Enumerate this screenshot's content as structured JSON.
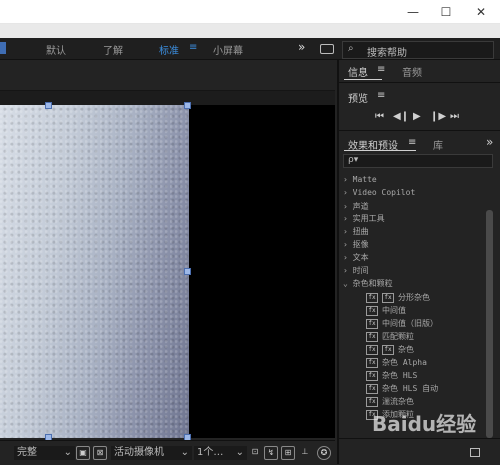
{
  "window": {
    "minimize": "—",
    "maximize": "☐",
    "close": "✕"
  },
  "workspaces": {
    "items": [
      "默认",
      "了解",
      "标准",
      "小屏幕"
    ],
    "active": "标准",
    "menu_glyph": "≡",
    "more": "»"
  },
  "help": {
    "search_placeholder": "搜索帮助"
  },
  "info_panel": {
    "tabs": [
      "信息",
      "音频"
    ],
    "active": "信息",
    "menu_glyph": "≡"
  },
  "preview_panel": {
    "title": "预览",
    "menu_glyph": "≡",
    "controls": [
      "⏮",
      "◀❙",
      "▶",
      "❙▶",
      "⏭"
    ]
  },
  "effects_panel": {
    "tabs": [
      "效果和预设",
      "库"
    ],
    "active": "效果和预设",
    "menu_glyph": "≡",
    "more": "»",
    "search_placeholder": "ρ▾",
    "categories": [
      "Matte",
      "Video Copilot",
      "声道",
      "实用工具",
      "扭曲",
      "抠像",
      "文本",
      "时间",
      "杂色和颗粒"
    ],
    "expanded": "杂色和颗粒",
    "effects": [
      "分形杂色",
      "中间值",
      "中间值（旧版）",
      "匹配颗粒",
      "杂色",
      "杂色 Alpha",
      "杂色 HLS",
      "杂色 HLS 自动",
      "湍流杂色",
      "添加颗粒"
    ]
  },
  "bottom_bar": {
    "quality": "完整",
    "camera": "活动摄像机",
    "views": "1个…"
  },
  "watermark": "Baidu经验"
}
